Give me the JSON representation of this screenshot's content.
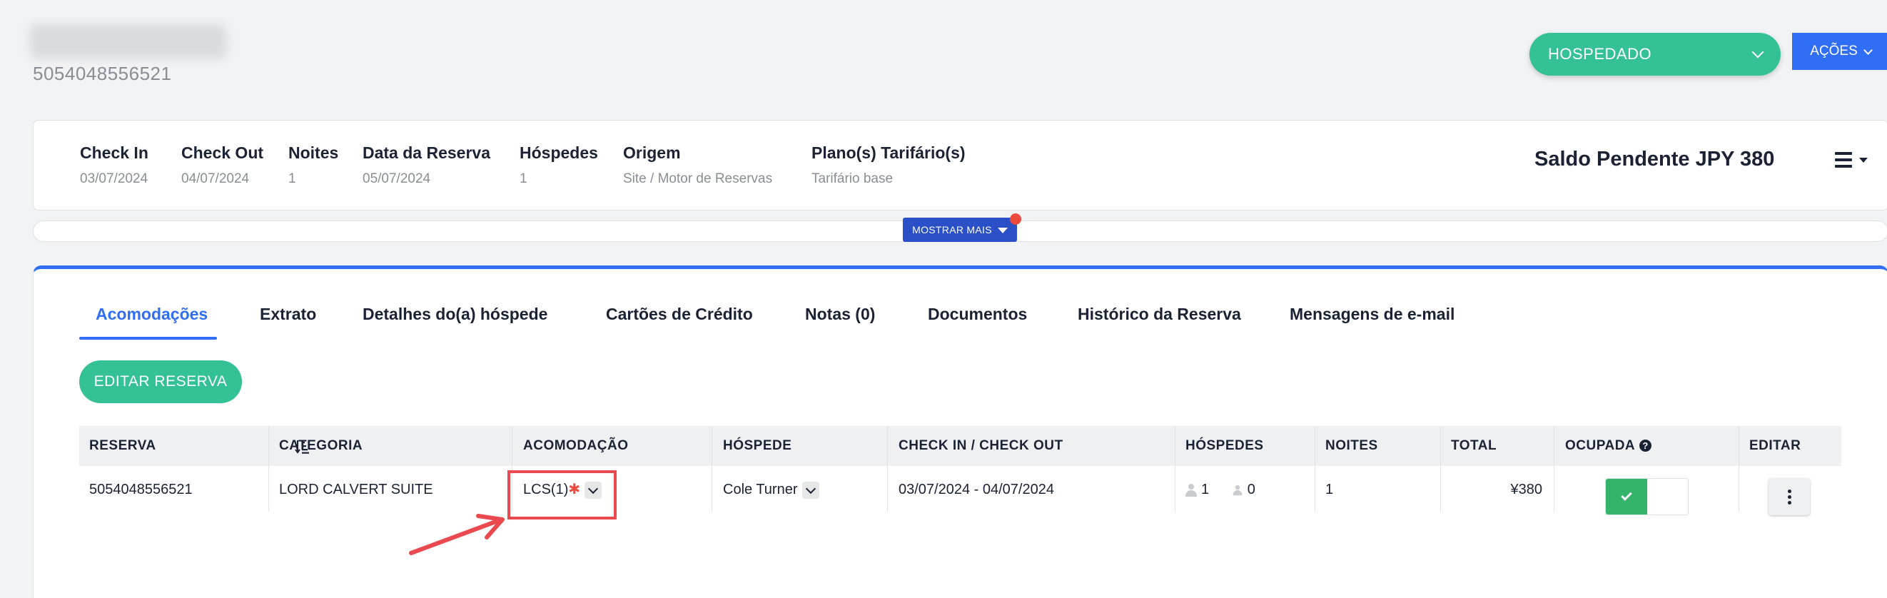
{
  "header": {
    "reservation_id": "5054048556521",
    "status": "HOSPEDADO",
    "actions_label": "AÇÕES"
  },
  "summary": {
    "fields": [
      {
        "label": "Check In",
        "value": "03/07/2024"
      },
      {
        "label": "Check Out",
        "value": "04/07/2024"
      },
      {
        "label": "Noites",
        "value": "1"
      },
      {
        "label": "Data da Reserva",
        "value": "05/07/2024"
      },
      {
        "label": "Hóspedes",
        "value": "1"
      },
      {
        "label": "Origem",
        "value": "Site / Motor de Reservas"
      },
      {
        "label": "Plano(s) Tarifário(s)",
        "value": "Tarifário base"
      }
    ],
    "balance": "Saldo Pendente JPY 380",
    "show_more": "MOSTRAR MAIS"
  },
  "tabs": [
    {
      "label": "Acomodações",
      "active": true
    },
    {
      "label": "Extrato"
    },
    {
      "label": "Detalhes do(a) hóspede"
    },
    {
      "label": "Cartões de Crédito"
    },
    {
      "label": "Notas (0)"
    },
    {
      "label": "Documentos"
    },
    {
      "label": "Histórico da Reserva"
    },
    {
      "label": "Mensagens de e-mail"
    }
  ],
  "edit_reservation_label": "EDITAR RESERVA",
  "table": {
    "columns": [
      "RESERVA",
      "CATEGORIA",
      "ACOMODAÇÃO",
      "HÓSPEDE",
      "CHECK IN / CHECK OUT",
      "HÓSPEDES",
      "NOITES",
      "TOTAL",
      "OCUPADA",
      "EDITAR"
    ],
    "rows": [
      {
        "reserva": "5054048556521",
        "categoria": "LORD CALVERT SUITE",
        "acomodacao": "LCS(1)",
        "acomodacao_flag": "✱",
        "hospede": "Cole Turner",
        "datas": "03/07/2024 - 04/07/2024",
        "adultos": "1",
        "criancas": "0",
        "noites": "1",
        "total": "¥380",
        "ocupada": true
      }
    ]
  },
  "colors": {
    "primary_blue": "#2f6ef5",
    "status_green": "#34c195",
    "highlight_red": "#ea4a4f"
  }
}
